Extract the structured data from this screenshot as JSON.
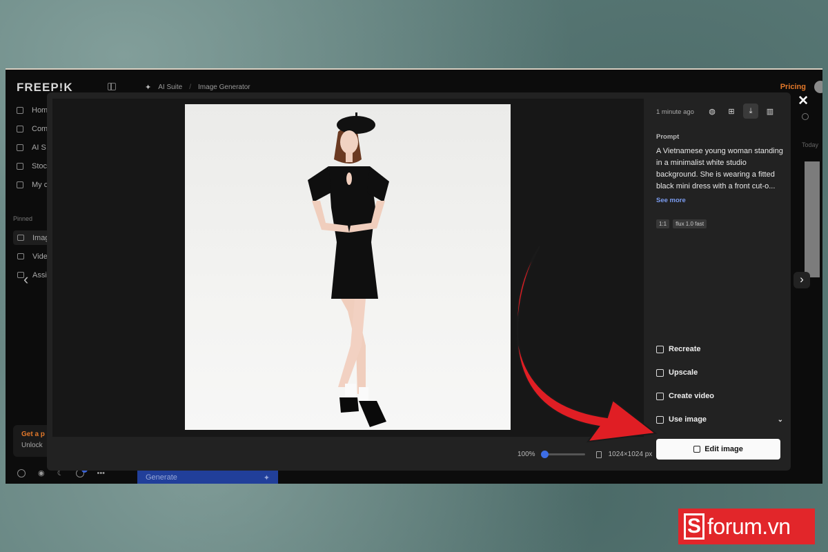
{
  "app": {
    "logo": "FREEP!K",
    "breadcrumbs": [
      "AI Suite",
      "Image Generator"
    ],
    "pricing": "Pricing",
    "nav_items": [
      "Hom",
      "Com",
      "AI S",
      "Stoc",
      "My c"
    ],
    "pinned_label": "Pinned",
    "pinned_items": [
      "Imag",
      "Vide",
      "Assi"
    ],
    "promo": {
      "line1": "Get a p",
      "line2": "Unlock"
    },
    "generate_label": "Generate",
    "notification_count": "9",
    "right_date": "Today"
  },
  "modal": {
    "time": "1 minute ago",
    "prompt_label": "Prompt",
    "prompt_text": "A Vietnamese young woman standing in a minimalist white studio background. She is wearing a fitted black mini dress with a front cut-o...",
    "see_more": "See more",
    "tags": [
      "1:1",
      "flux 1.0 fast"
    ],
    "actions": [
      {
        "label": "Recreate",
        "icon": "recreate-icon"
      },
      {
        "label": "Upscale",
        "icon": "upscale-icon"
      },
      {
        "label": "Create video",
        "icon": "video-icon"
      },
      {
        "label": "Use image",
        "icon": "use-image-icon",
        "has_dropdown": true
      }
    ],
    "edit_button": "Edit image",
    "zoom": "100%",
    "zoom_fraction": 0,
    "dimensions": "1024×1024 px",
    "top_icons": [
      "globe-icon",
      "folder-add-icon",
      "download-icon",
      "trash-icon"
    ]
  },
  "watermark": {
    "letter": "S",
    "text": "forum.vn"
  },
  "colors": {
    "accent_blue": "#3d6ee6",
    "pricing_orange": "#e2782a",
    "arrow_red": "#e01e24",
    "watermark_red": "#e2262a"
  }
}
